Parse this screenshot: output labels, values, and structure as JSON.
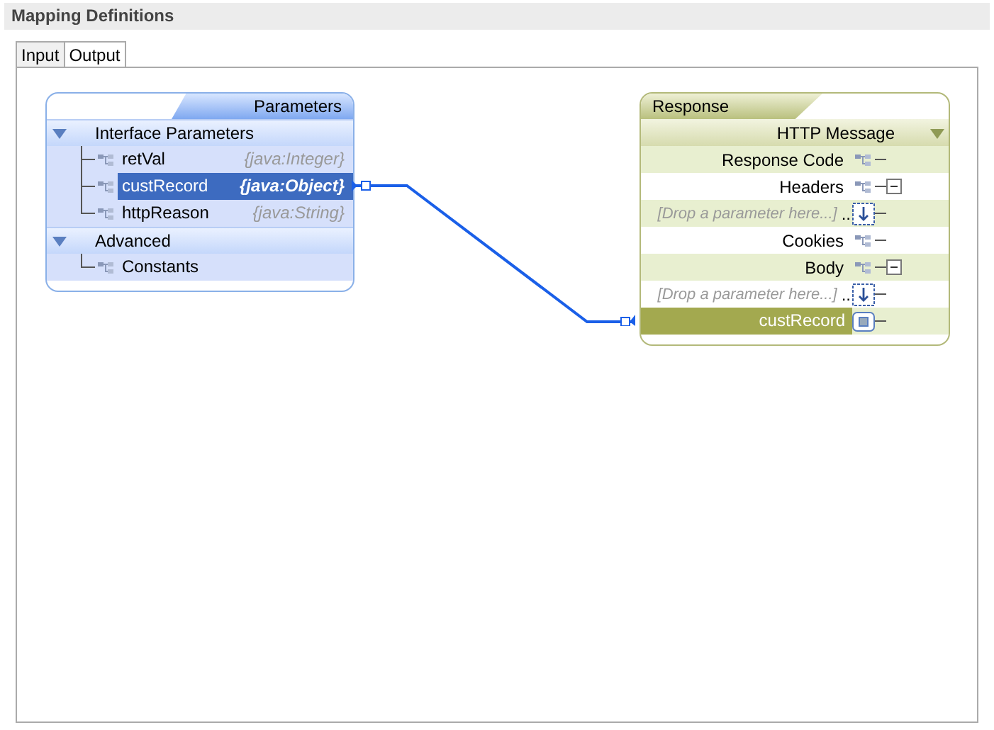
{
  "panel_title": "Mapping Definitions",
  "tabs": [
    {
      "label": "Input",
      "selected": false
    },
    {
      "label": "Output",
      "selected": true
    }
  ],
  "parameters_node": {
    "title": "Parameters",
    "groups": [
      {
        "label": "Interface Parameters",
        "expanded": true,
        "children": [
          {
            "name": "retVal",
            "type": "{java:Integer}",
            "selected": false
          },
          {
            "name": "custRecord",
            "type": "{java:Object}",
            "selected": true
          },
          {
            "name": "httpReason",
            "type": "{java:String}",
            "selected": false
          }
        ]
      },
      {
        "label": "Advanced",
        "expanded": true,
        "children": [
          {
            "name": "Constants",
            "selected": false
          }
        ]
      }
    ]
  },
  "response_node": {
    "title": "Response",
    "section": "HTTP Message",
    "rows": [
      {
        "kind": "field",
        "label": "Response Code"
      },
      {
        "kind": "field",
        "label": "Headers",
        "expanded": true
      },
      {
        "kind": "drop",
        "placeholder": "[Drop a parameter here...]",
        "suffix": ".."
      },
      {
        "kind": "field",
        "label": "Cookies"
      },
      {
        "kind": "field",
        "label": "Body",
        "expanded": true
      },
      {
        "kind": "drop",
        "placeholder": "[Drop a parameter here...]",
        "suffix": ".."
      },
      {
        "kind": "mapped",
        "label": "custRecord"
      }
    ]
  }
}
